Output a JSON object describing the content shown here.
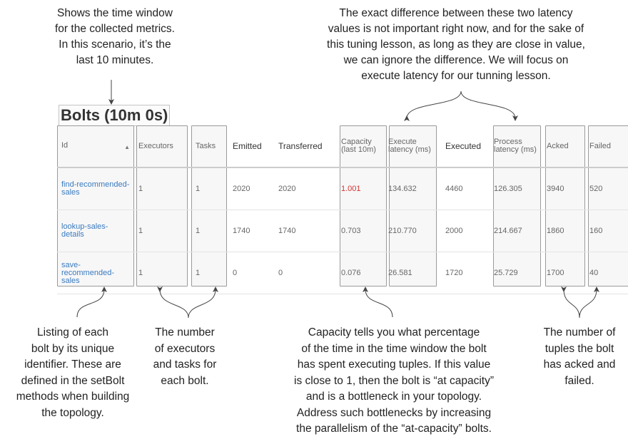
{
  "callouts": {
    "time_window": "Shows the time window\nfor the collected metrics.\nIn this scenario, it’s the\nlast 10 minutes.",
    "latency": "The exact difference between these two latency\nvalues is not important right now, and for the sake of\nthis tuning lesson, as long as they are close in value,\nwe can ignore the difference. We will focus on\nexecute latency for our tunning lesson.",
    "listing": "Listing of each\nbolt by its unique\nidentifier. These are\ndefined in the setBolt\nmethods when building\nthe topology.",
    "executors_tasks": "The number\nof executors\nand tasks for\neach bolt.",
    "capacity": "Capacity tells you what percentage\nof the time in the time window the bolt\nhas spent executing tuples. If this value\nis close to 1, then the bolt is “at capacity”\nand is a bottleneck in your topology.\nAddress such bottlenecks by increasing\nthe parallelism of the “at-capacity” bolts.",
    "acked_failed": "The number of\ntuples the bolt\nhas acked and\nfailed."
  },
  "section_title": "Bolts (10m 0s)",
  "columns": [
    "Id",
    "Executors",
    "Tasks",
    "Emitted",
    "Transferred",
    "Capacity (last 10m)",
    "Execute latency (ms)",
    "Executed",
    "Process latency (ms)",
    "Acked",
    "Failed"
  ],
  "sort_icon": "sort-up-icon",
  "capacity_alert_color": "#d33333",
  "link_color": "#3a7bc0",
  "rows": [
    [
      "find-recommended-sales",
      "1",
      "1",
      "2020",
      "2020",
      "1.001",
      "134.632",
      "4460",
      "126.305",
      "3940",
      "520"
    ],
    [
      "lookup-sales-details",
      "1",
      "1",
      "1740",
      "1740",
      "0.703",
      "210.770",
      "2000",
      "214.667",
      "1860",
      "160"
    ],
    [
      "save-recommended-sales",
      "1",
      "1",
      "0",
      "0",
      "0.076",
      "26.581",
      "1720",
      "25.729",
      "1700",
      "40"
    ]
  ]
}
